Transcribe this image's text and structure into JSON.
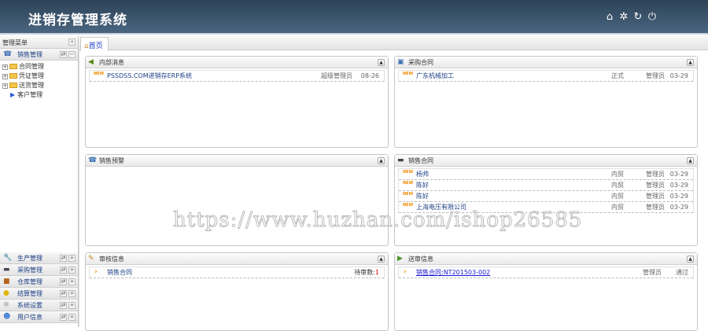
{
  "header": {
    "title": "进销存管理系统",
    "icons": [
      "home-icon",
      "gear-icon",
      "refresh-icon",
      "power-icon"
    ]
  },
  "sidebar": {
    "title": "管理菜单",
    "active_group": "销售管理",
    "tree": [
      "合同管理",
      "凭证管理",
      "送货管理",
      "客户管理"
    ],
    "groups": [
      "生产管理",
      "采购管理",
      "仓库管理",
      "结算管理",
      "系统设置",
      "用户信息"
    ]
  },
  "tab": {
    "label": "首页"
  },
  "panels": {
    "internal": {
      "title": "内部消息",
      "rows": [
        {
          "text": "PSSDSS.COM进销存ERP系统",
          "author": "超级管理员",
          "date": "08-26"
        }
      ]
    },
    "purchase": {
      "title": "采购合同",
      "rows": [
        {
          "text": "广东机械加工",
          "type": "正式",
          "author": "管理员",
          "date": "03-29"
        }
      ]
    },
    "warning": {
      "title": "销售预警"
    },
    "sales": {
      "title": "销售合同",
      "rows": [
        {
          "text": "杨帅",
          "type": "内贸",
          "author": "管理员",
          "date": "03-29"
        },
        {
          "text": "陈好",
          "type": "内贸",
          "author": "管理员",
          "date": "03-29"
        },
        {
          "text": "陈好",
          "type": "内贸",
          "author": "管理员",
          "date": "03-29"
        },
        {
          "text": "上海电压有限公司",
          "type": "内贸",
          "author": "管理员",
          "date": "03-29"
        }
      ]
    },
    "audit": {
      "title": "审核信息",
      "rows": [
        {
          "text": "销售合同",
          "label": "待审数:",
          "count": "1"
        }
      ]
    },
    "submit": {
      "title": "送审信息",
      "rows": [
        {
          "text": "销售合同:NT201503-002",
          "author": "管理员",
          "status": "通过"
        }
      ]
    }
  },
  "new_badge": "NEW",
  "watermark": "https://www.huzhan.com/ishop26585"
}
